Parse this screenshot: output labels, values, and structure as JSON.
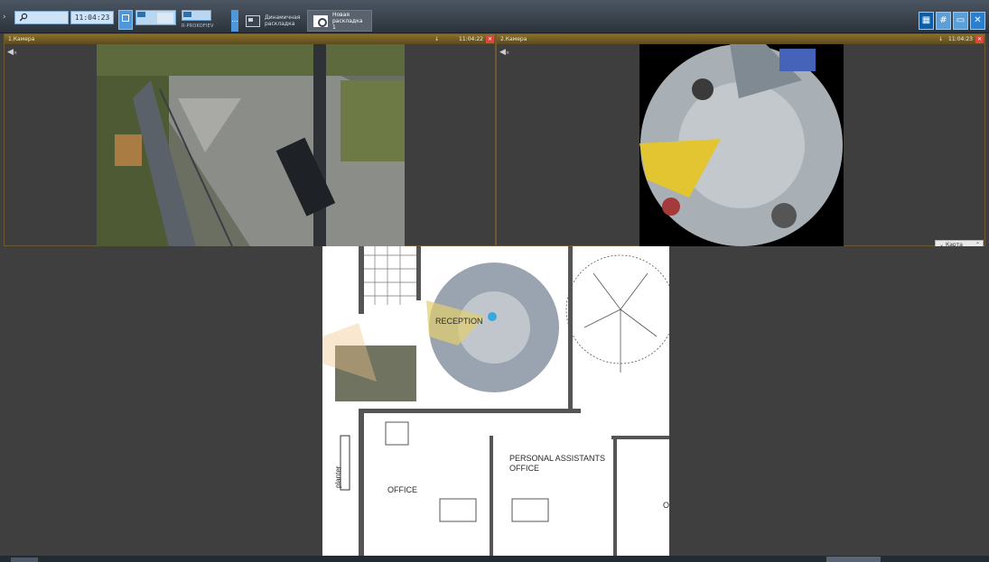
{
  "toolbar": {
    "search_icon": "search-icon",
    "time": "11:04:23",
    "thumbnail_label": "R-PROKOFIEV",
    "more": "...",
    "tabs": [
      {
        "label_line1": "Динамичная",
        "label_line2": "раскладка",
        "active": false
      },
      {
        "label_line1": "Новая",
        "label_line2": "раскладка 1",
        "active": true
      }
    ],
    "tools": [
      "grid-layout-icon",
      "grid-icon",
      "window-icon",
      "settings-tool-icon"
    ]
  },
  "cameras": [
    {
      "title": "1.Камера",
      "time": "11:04:22"
    },
    {
      "title": "2.Камера",
      "time": "11:04:23"
    }
  ],
  "map_button": {
    "label": "Карта"
  },
  "floorplan": {
    "rooms": [
      "RECEPTION",
      "PERSONAL ASSISTANTS",
      "OFFICE",
      "OFFICE",
      "planter",
      "O"
    ]
  },
  "colors": {
    "accent": "#4f97d8",
    "tile_header": "#7a6226",
    "close": "#d74a3a"
  }
}
